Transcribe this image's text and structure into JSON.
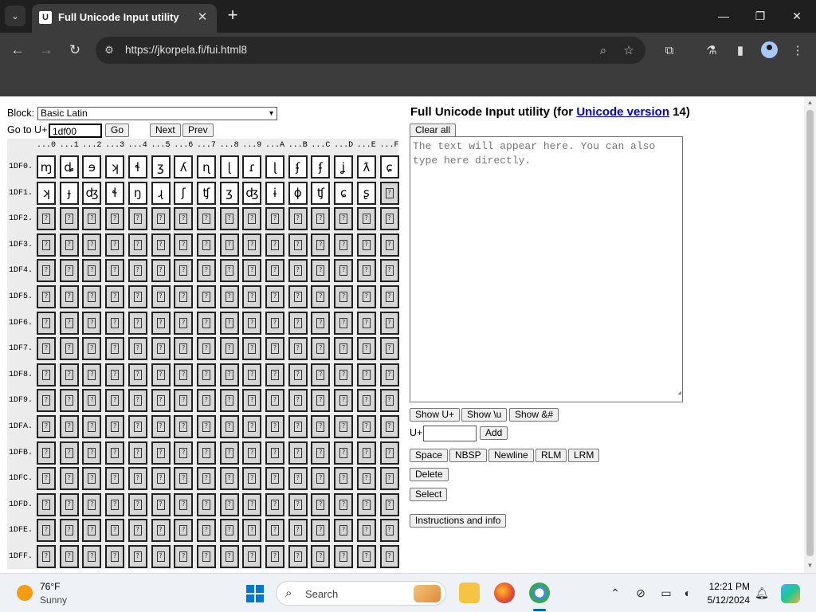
{
  "browser": {
    "tab_title": "Full Unicode Input utility",
    "favicon_text": "U",
    "url": "https://jkorpela.fi/fui.html8",
    "icons": [
      "tab-search-icon",
      "close-icon",
      "plus-icon",
      "minimize-icon",
      "restore-icon",
      "close-window-icon",
      "back-icon",
      "forward-icon",
      "reload-icon",
      "site-info-icon",
      "zoom-icon",
      "star-icon",
      "extensions-icon",
      "labs-icon",
      "sidebar-icon",
      "profile-icon",
      "kebab-menu-icon"
    ]
  },
  "form": {
    "block_label": "Block:",
    "block_value": "Basic Latin",
    "goto_label": "Go to U+",
    "goto_value": "1df00",
    "go_button": "Go",
    "next_button": "Next",
    "prev_button": "Prev"
  },
  "grid": {
    "columns": [
      "...0",
      "...1",
      "...2",
      "...3",
      "...4",
      "...5",
      "...6",
      "...7",
      "...8",
      "...9",
      "...A",
      "...B",
      "...C",
      "...D",
      "...E",
      "...F"
    ],
    "rows": [
      {
        "label": "1DF0.",
        "chars": [
          "ɱ",
          "ȡ",
          "ɘ",
          "ʞ",
          "ɬ",
          "ʒ",
          "ʎ",
          "ɳ",
          "ɭ",
          "ɾ",
          "ɭ",
          "ʄ",
          "ʄ",
          "ʝ",
          "ƛ",
          "ɕ"
        ]
      },
      {
        "label": "1DF1.",
        "chars": [
          "ʞ",
          "ɟ",
          "ʤ",
          "ɬ",
          "ŋ",
          "ɻ",
          "ʃ",
          "ʧ",
          "ʒ",
          "ʤ",
          "ɨ",
          "ɸ",
          "ʧ",
          "ɕ",
          "ʂ",
          ""
        ]
      },
      {
        "label": "1DF2.",
        "chars": []
      },
      {
        "label": "1DF3.",
        "chars": []
      },
      {
        "label": "1DF4.",
        "chars": []
      },
      {
        "label": "1DF5.",
        "chars": []
      },
      {
        "label": "1DF6.",
        "chars": []
      },
      {
        "label": "1DF7.",
        "chars": []
      },
      {
        "label": "1DF8.",
        "chars": []
      },
      {
        "label": "1DF9.",
        "chars": []
      },
      {
        "label": "1DFA.",
        "chars": []
      },
      {
        "label": "1DFB.",
        "chars": []
      },
      {
        "label": "1DFC.",
        "chars": []
      },
      {
        "label": "1DFD.",
        "chars": []
      },
      {
        "label": "1DFE.",
        "chars": []
      },
      {
        "label": "1DFF.",
        "chars": []
      }
    ]
  },
  "right": {
    "heading_prefix": "Full Unicode Input utility (for ",
    "heading_link": "Unicode version",
    "heading_suffix": " 14)",
    "clear_all": "Clear all",
    "textarea_placeholder": "The text will appear here. You can also type here directly.",
    "show_u": "Show U+",
    "show_backslash_u": "Show \\u",
    "show_amp": "Show &#",
    "uplus_label": "U+",
    "uplus_value": "",
    "add": "Add",
    "space": "Space",
    "nbsp": "NBSP",
    "newline": "Newline",
    "rlm": "RLM",
    "lrm": "LRM",
    "delete": "Delete",
    "select": "Select",
    "instructions": "Instructions and info"
  },
  "taskbar": {
    "weather_temp": "76°F",
    "weather_cond": "Sunny",
    "search_text": "Search",
    "time": "12:21 PM",
    "date": "5/12/2024"
  }
}
